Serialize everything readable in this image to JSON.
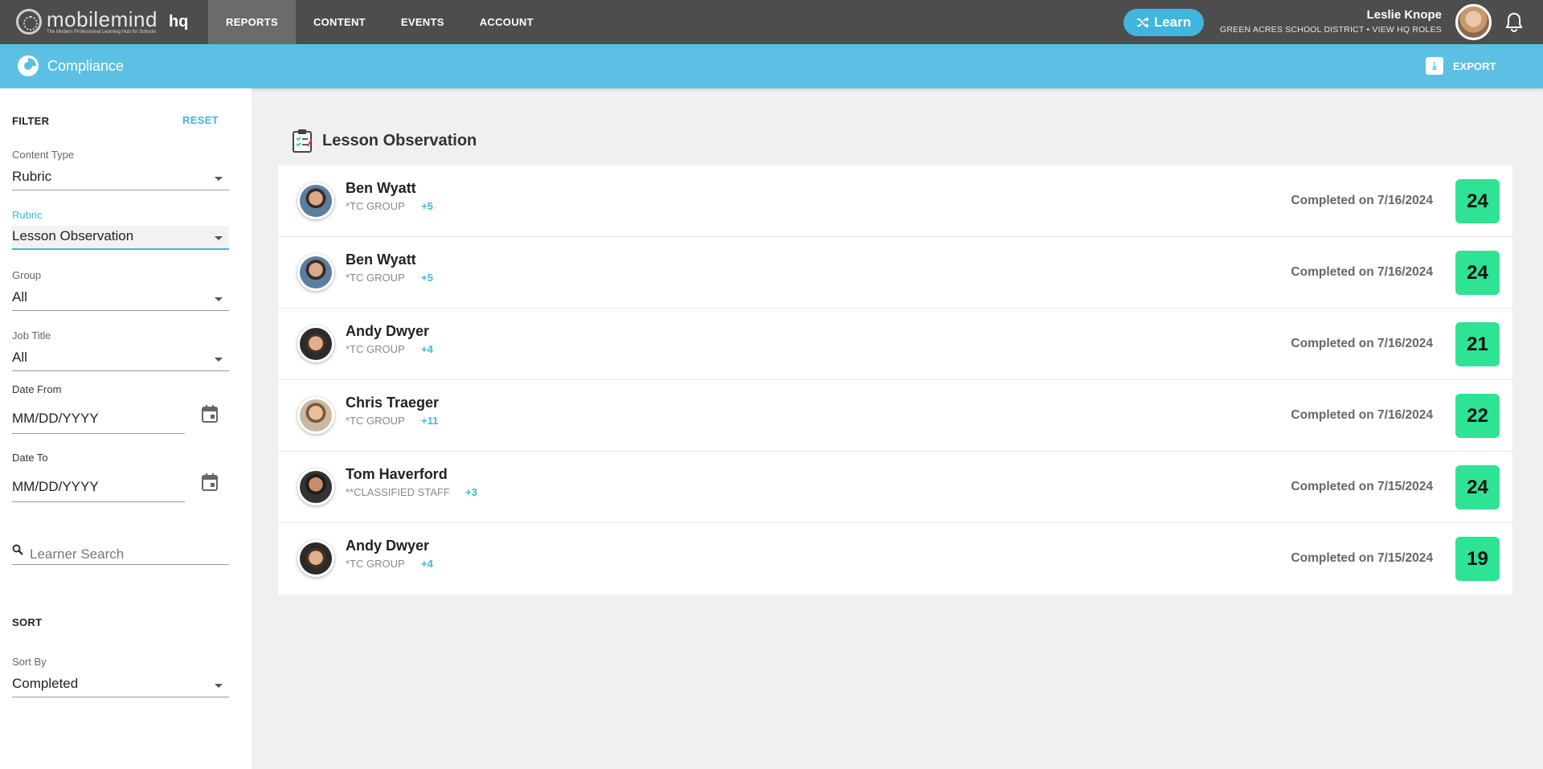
{
  "header": {
    "logo_word": "mobilemind",
    "logo_tagline": "The Modern Professional Learning Hub for Schools",
    "logo_hq": "hq",
    "nav": [
      {
        "label": "REPORTS",
        "active": true
      },
      {
        "label": "CONTENT",
        "active": false
      },
      {
        "label": "EVENTS",
        "active": false
      },
      {
        "label": "ACCOUNT",
        "active": false
      }
    ],
    "learn_label": "Learn",
    "user_name": "Leslie Knope",
    "user_district": "GREEN ACRES SCHOOL DISTRICT • VIEW HQ ROLES"
  },
  "titlebar": {
    "title": "Compliance",
    "export_label": "EXPORT"
  },
  "filter": {
    "title": "FILTER",
    "reset_label": "RESET",
    "content_type_label": "Content Type",
    "content_type_value": "Rubric",
    "rubric_label": "Rubric",
    "rubric_value": "Lesson Observation",
    "group_label": "Group",
    "group_value": "All",
    "job_title_label": "Job Title",
    "job_title_value": "All",
    "date_from_label": "Date From",
    "date_from_placeholder": "MM/DD/YYYY",
    "date_to_label": "Date To",
    "date_to_placeholder": "MM/DD/YYYY",
    "search_placeholder": "Learner Search"
  },
  "sort": {
    "title": "SORT",
    "sort_by_label": "Sort By",
    "sort_by_value": "Completed"
  },
  "main": {
    "section_title": "Lesson Observation",
    "rows": [
      {
        "name": "Ben Wyatt",
        "group": "*TC GROUP",
        "extra": "+5",
        "completed": "Completed on 7/16/2024",
        "score": "24"
      },
      {
        "name": "Ben Wyatt",
        "group": "*TC GROUP",
        "extra": "+5",
        "completed": "Completed on 7/16/2024",
        "score": "24"
      },
      {
        "name": "Andy Dwyer",
        "group": "*TC GROUP",
        "extra": "+4",
        "completed": "Completed on 7/16/2024",
        "score": "21"
      },
      {
        "name": "Chris Traeger",
        "group": "*TC GROUP",
        "extra": "+11",
        "completed": "Completed on 7/16/2024",
        "score": "22"
      },
      {
        "name": "Tom Haverford",
        "group": "**CLASSIFIED STAFF",
        "extra": "+3",
        "completed": "Completed on 7/15/2024",
        "score": "24"
      },
      {
        "name": "Andy Dwyer",
        "group": "*TC GROUP",
        "extra": "+4",
        "completed": "Completed on 7/15/2024",
        "score": "19"
      }
    ]
  },
  "colors": {
    "accent": "#5bc0e3",
    "link": "#3fb6de",
    "score_badge": "#2ee394",
    "nav_bg": "#4d4d4d"
  }
}
